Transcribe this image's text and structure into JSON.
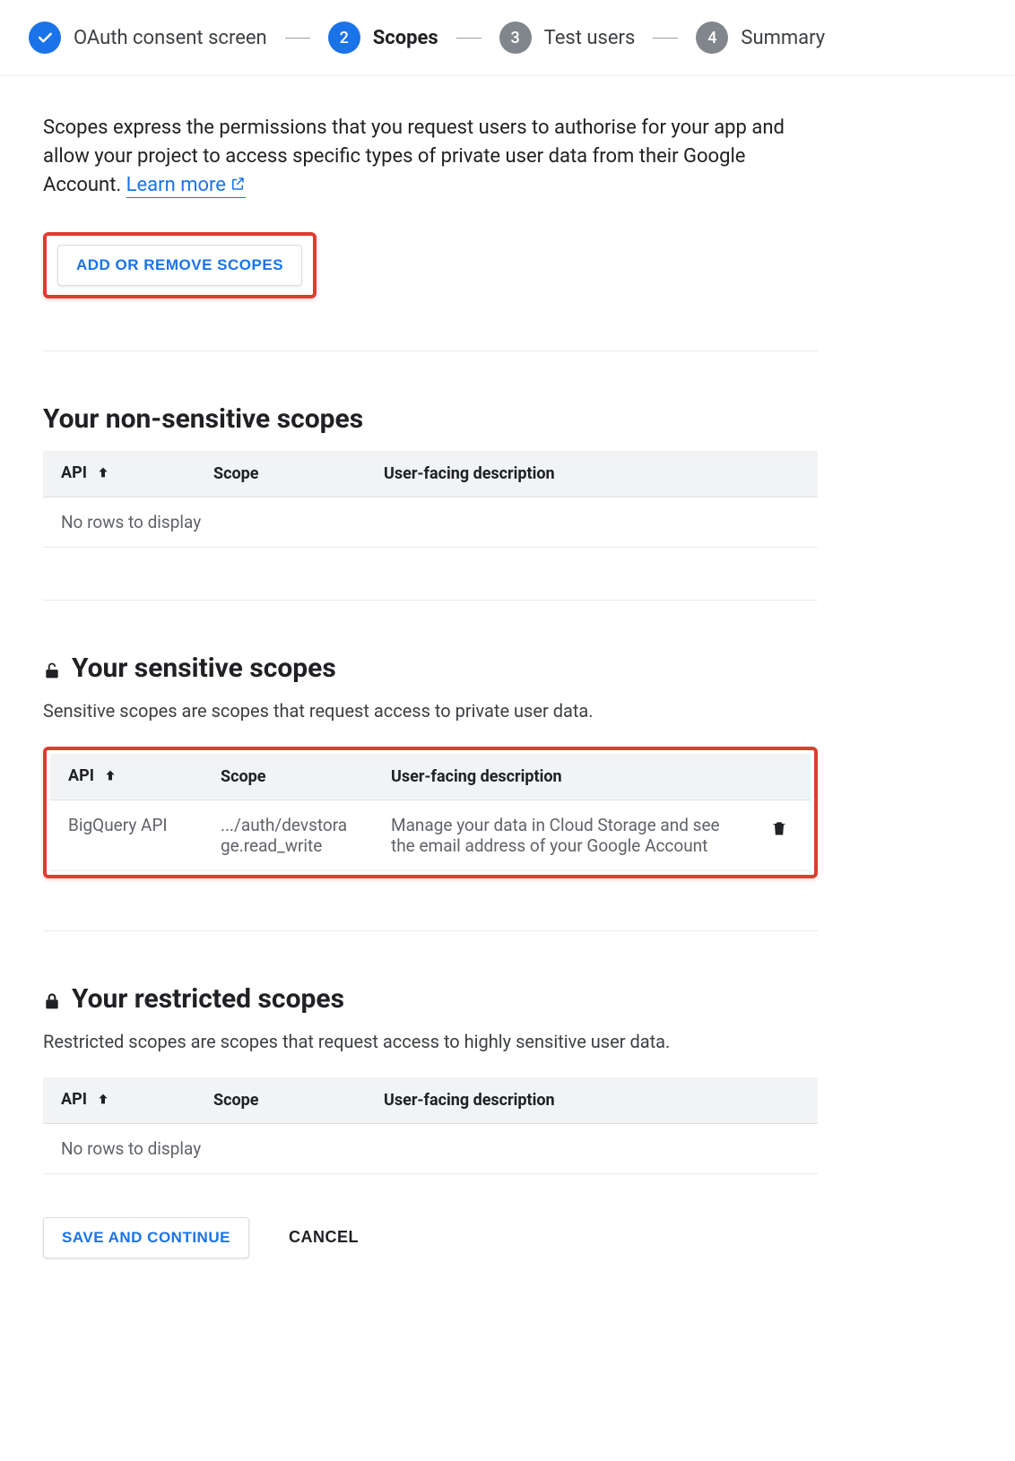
{
  "stepper": {
    "steps": [
      {
        "label": "OAuth consent screen",
        "state": "complete"
      },
      {
        "num": "2",
        "label": "Scopes",
        "state": "active"
      },
      {
        "num": "3",
        "label": "Test users",
        "state": "pending"
      },
      {
        "num": "4",
        "label": "Summary",
        "state": "pending"
      }
    ]
  },
  "intro": {
    "text": "Scopes express the permissions that you request users to authorise for your app and allow your project to access specific types of private user data from their Google Account. ",
    "learn_more": "Learn more"
  },
  "buttons": {
    "add_remove": "ADD OR REMOVE SCOPES",
    "save_continue": "SAVE AND CONTINUE",
    "cancel": "CANCEL"
  },
  "headers": {
    "api": "API",
    "scope": "Scope",
    "desc": "User-facing description"
  },
  "empty_msg": "No rows to display",
  "sections": {
    "non_sensitive": {
      "title": "Your non-sensitive scopes"
    },
    "sensitive": {
      "title": "Your sensitive scopes",
      "sub": "Sensitive scopes are scopes that request access to private user data.",
      "rows": [
        {
          "api": "BigQuery API",
          "scope": ".../auth/devstorage.read_write",
          "desc": "Manage your data in Cloud Storage and see the email address of your Google Account"
        }
      ]
    },
    "restricted": {
      "title": "Your restricted scopes",
      "sub": "Restricted scopes are scopes that request access to highly sensitive user data."
    }
  }
}
